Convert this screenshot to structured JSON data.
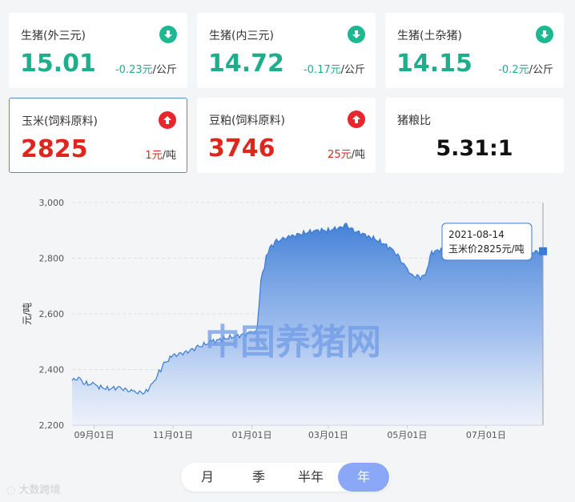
{
  "cards": [
    {
      "title": "生猪(外三元)",
      "value": "15.01",
      "change": "-0.23元",
      "unit": "/公斤",
      "trend": "down"
    },
    {
      "title": "生猪(内三元)",
      "value": "14.72",
      "change": "-0.17元",
      "unit": "/公斤",
      "trend": "down"
    },
    {
      "title": "生猪(土杂猪)",
      "value": "14.15",
      "change": "-0.2元",
      "unit": "/公斤",
      "trend": "down"
    },
    {
      "title": "玉米(饲料原料)",
      "value": "2825",
      "change": "1元",
      "unit": "/吨",
      "trend": "up"
    },
    {
      "title": "豆粕(饲料原料)",
      "value": "3746",
      "change": "25元",
      "unit": "/吨",
      "trend": "up"
    },
    {
      "title": "猪粮比",
      "value": "5.31:1"
    }
  ],
  "colors": {
    "down": "#1bb891",
    "up": "#e8262b",
    "line": "#3a7bd5",
    "active": "#8aa8f7"
  },
  "watermark": "中国养猪网",
  "tooltip": {
    "date": "2021-08-14",
    "text": "玉米价2825元/吨"
  },
  "chart_data": {
    "type": "area",
    "ylabel": "元/吨",
    "ylim": [
      2200,
      3000
    ],
    "yticks": [
      "2,200",
      "2,400",
      "2,600",
      "2,800",
      "3,000"
    ],
    "xticks": [
      "09月01日",
      "11月01日",
      "01月01日",
      "03月01日",
      "05月01日",
      "07月01日"
    ],
    "grid": true,
    "series": [
      {
        "x": [
          "2020-08-15",
          "2020-08-20",
          "2020-08-25",
          "2020-09-01",
          "2020-09-10",
          "2020-09-20",
          "2020-10-01",
          "2020-10-10",
          "2020-10-15",
          "2020-10-20",
          "2020-10-25",
          "2020-11-01",
          "2020-11-10",
          "2020-11-20",
          "2020-12-01",
          "2020-12-10",
          "2020-12-20",
          "2020-12-31",
          "2021-01-05",
          "2021-01-08",
          "2021-01-12",
          "2021-01-15",
          "2021-01-20",
          "2021-01-25",
          "2021-02-01",
          "2021-02-10",
          "2021-02-20",
          "2021-03-01",
          "2021-03-10",
          "2021-03-15",
          "2021-03-20",
          "2021-04-01",
          "2021-04-10",
          "2021-04-20",
          "2021-04-25",
          "2021-05-01",
          "2021-05-05",
          "2021-05-10",
          "2021-05-15",
          "2021-05-20",
          "2021-06-01",
          "2021-06-10",
          "2021-06-20",
          "2021-07-01",
          "2021-07-10",
          "2021-07-20",
          "2021-08-01",
          "2021-08-14"
        ],
        "values": [
          2360,
          2370,
          2350,
          2345,
          2330,
          2335,
          2320,
          2315,
          2340,
          2380,
          2420,
          2450,
          2460,
          2480,
          2500,
          2510,
          2520,
          2530,
          2540,
          2720,
          2800,
          2840,
          2860,
          2870,
          2880,
          2890,
          2900,
          2900,
          2910,
          2920,
          2900,
          2880,
          2860,
          2830,
          2800,
          2760,
          2740,
          2730,
          2740,
          2820,
          2840,
          2850,
          2830,
          2820,
          2815,
          2820,
          2820,
          2825
        ]
      }
    ]
  },
  "periods": [
    {
      "label": "月",
      "active": false
    },
    {
      "label": "季",
      "active": false
    },
    {
      "label": "半年",
      "active": false
    },
    {
      "label": "年",
      "active": true
    }
  ],
  "brand": "大数跨境"
}
